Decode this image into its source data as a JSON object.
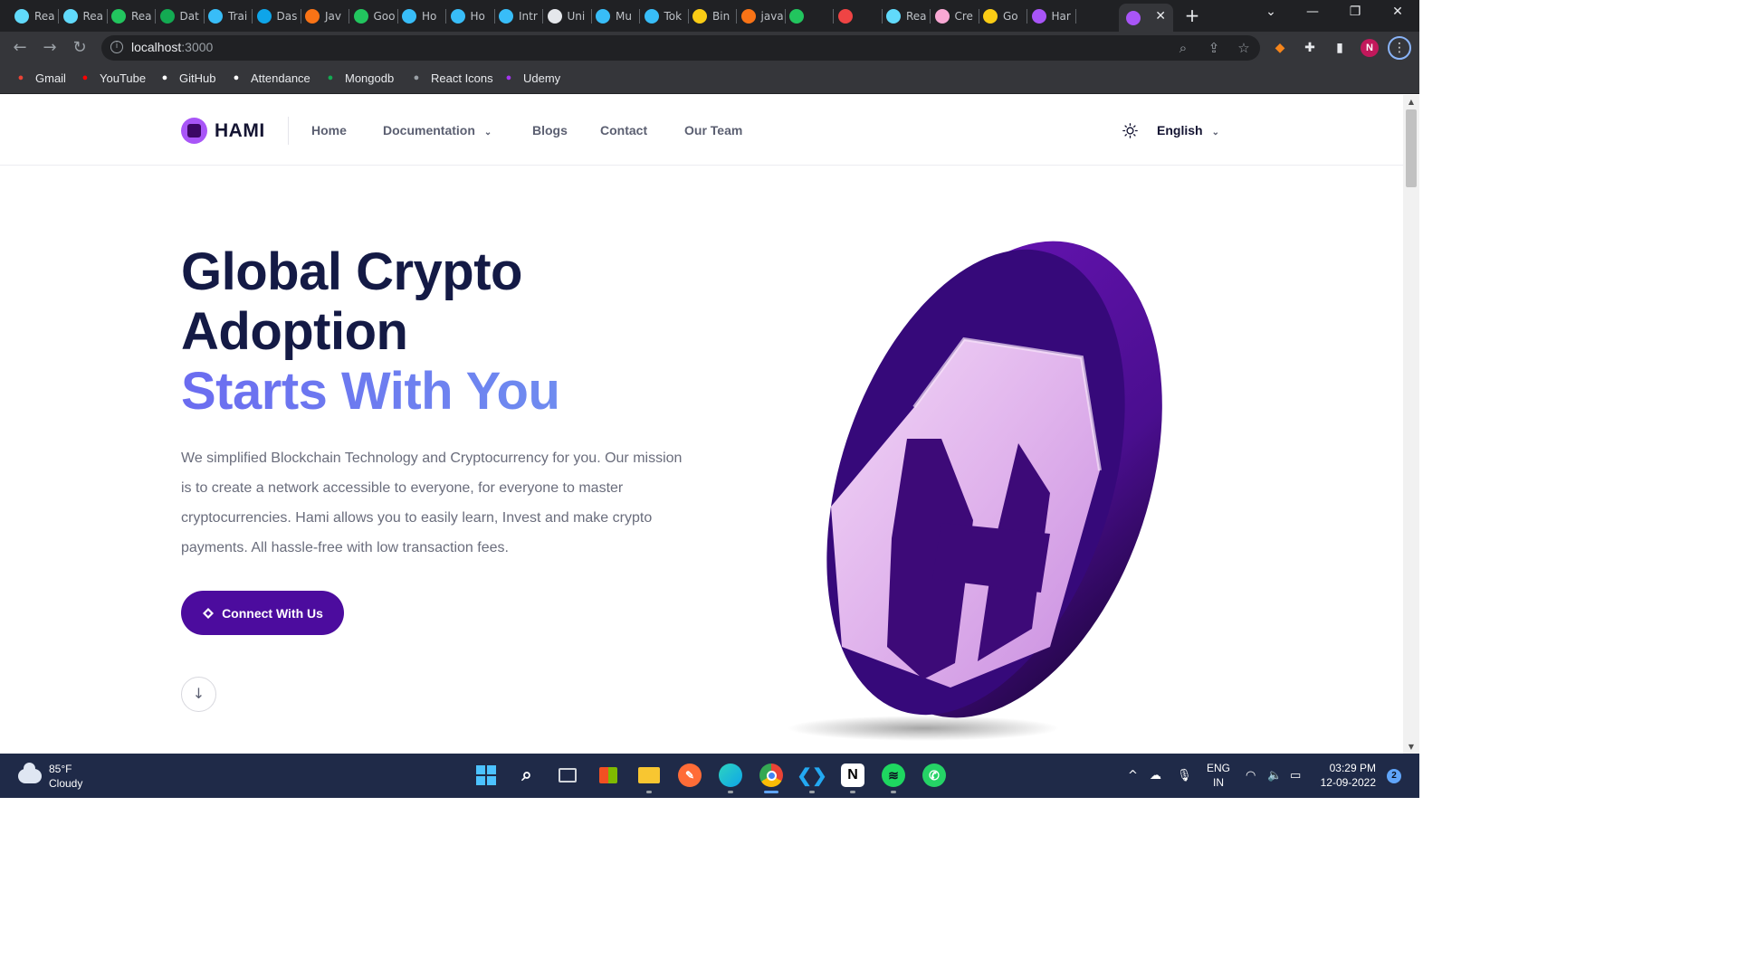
{
  "browser": {
    "tabs": [
      {
        "label": "Rea",
        "icon": "react-icon",
        "color": "#61dafb"
      },
      {
        "label": "Rea",
        "icon": "react-icon",
        "color": "#61dafb"
      },
      {
        "label": "Rea",
        "icon": "w-icon",
        "color": "#22c55e"
      },
      {
        "label": "Dat",
        "icon": "mongodb-icon",
        "color": "#13aa52"
      },
      {
        "label": "Trai",
        "icon": "tailwind-icon",
        "color": "#38bdf8"
      },
      {
        "label": "Das",
        "icon": "edge-icon",
        "color": "#0ea5e9"
      },
      {
        "label": "Jav",
        "icon": "java-icon",
        "color": "#f97316"
      },
      {
        "label": "Goo",
        "icon": "meet-icon",
        "color": "#22c55e"
      },
      {
        "label": "Ho",
        "icon": "heart-icon",
        "color": "#38bdf8"
      },
      {
        "label": "Ho",
        "icon": "heart-icon",
        "color": "#38bdf8"
      },
      {
        "label": "Intr",
        "icon": "heart-icon",
        "color": "#38bdf8"
      },
      {
        "label": "Uni",
        "icon": "unicorn-icon",
        "color": "#e5e7eb"
      },
      {
        "label": "Mu",
        "icon": "heart-icon",
        "color": "#38bdf8"
      },
      {
        "label": "Tok",
        "icon": "heart-icon",
        "color": "#38bdf8"
      },
      {
        "label": "Bin",
        "icon": "hand-icon",
        "color": "#facc15"
      },
      {
        "label": "java",
        "icon": "java-icon",
        "color": "#f97316"
      },
      {
        "label": "",
        "icon": "meet-icon",
        "color": "#22c55e"
      },
      {
        "label": "",
        "icon": "record-icon",
        "color": "#ef4444"
      },
      {
        "label": "Rea",
        "icon": "react-icon",
        "color": "#61dafb"
      },
      {
        "label": "Cre",
        "icon": "circle-icon",
        "color": "#f9a8d4"
      },
      {
        "label": "Go",
        "icon": "hand-icon",
        "color": "#facc15"
      },
      {
        "label": "Har",
        "icon": "hami-icon",
        "color": "#a855f7"
      }
    ],
    "active_tab_icon_color": "#a855f7",
    "url_host": "localhost",
    "url_port": ":3000",
    "profile_initial": "N",
    "bookmarks": [
      {
        "label": "Gmail",
        "icon": "gmail-icon",
        "color": "#ea4335"
      },
      {
        "label": "YouTube",
        "icon": "youtube-icon",
        "color": "#ff0000"
      },
      {
        "label": "GitHub",
        "icon": "github-icon",
        "color": "#ffffff"
      },
      {
        "label": "Attendance",
        "icon": "x-icon",
        "color": "#ffffff"
      },
      {
        "label": "Mongodb",
        "icon": "mongodb-icon",
        "color": "#13aa52"
      },
      {
        "label": "React Icons",
        "icon": "react-icons-icon",
        "color": "#9aa0a6"
      },
      {
        "label": "Udemy",
        "icon": "udemy-icon",
        "color": "#a435f0"
      }
    ]
  },
  "site": {
    "brand": "HAMI",
    "nav": {
      "home": "Home",
      "documentation": "Documentation",
      "blogs": "Blogs",
      "contact": "Contact",
      "team": "Our Team"
    },
    "language": "English",
    "hero": {
      "line1": "Global Crypto",
      "line2": "Adoption",
      "line3": "Starts With You",
      "description": "We simplified Blockchain Technology and Cryptocurrency for you. Our mission is to create a network accessible to everyone, for everyone to master cryptocurrencies. Hami allows you to easily learn, Invest and make crypto payments. All hassle-free with low transaction fees.",
      "cta_label": "Connect With Us"
    },
    "colors": {
      "title": "#141a45",
      "accent": "#6b6cf0",
      "cta": "#4c0c9e",
      "coin_dark": "#4a0e8f",
      "coin_light": "#e4b8f0"
    }
  },
  "taskbar": {
    "weather_temp": "85°F",
    "weather_desc": "Cloudy",
    "apps": [
      "start",
      "search",
      "task-view",
      "store",
      "explorer",
      "postman",
      "edge",
      "chrome",
      "vscode",
      "notion",
      "spotify",
      "whatsapp"
    ],
    "lang_line1": "ENG",
    "lang_line2": "IN",
    "time": "03:29 PM",
    "date": "12-09-2022",
    "notifications": "2"
  }
}
